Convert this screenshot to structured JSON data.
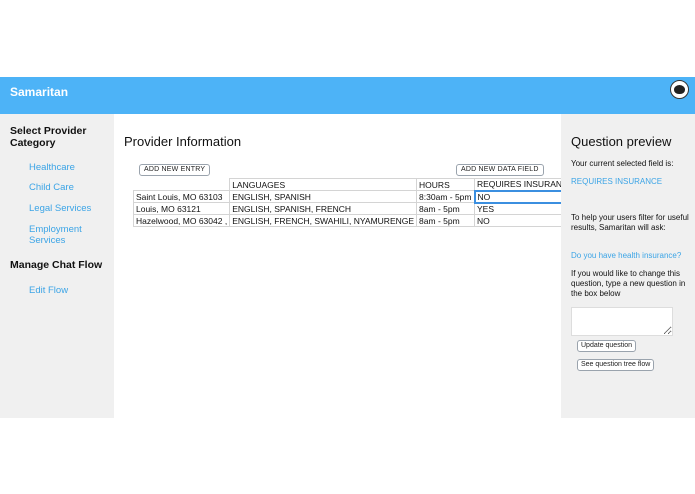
{
  "app": {
    "brand": "Samaritan",
    "logo_icon": "globe-icon"
  },
  "sidebar": {
    "select_heading": "Select Provider Category",
    "categories": [
      "Healthcare",
      "Child Care",
      "Legal Services",
      "Employment Services"
    ],
    "manage_heading": "Manage Chat Flow",
    "edit_flow": "Edit Flow"
  },
  "main": {
    "title": "Provider Information",
    "add_entry": "ADD NEW ENTRY",
    "add_field": "ADD NEW DATA FIELD",
    "columns": [
      "",
      "LANGUAGES",
      "HOURS",
      "REQUIRES INSURANCE"
    ],
    "rows": [
      [
        "Saint Louis, MO 63103",
        "ENGLISH, SPANISH",
        "8:30am - 5pm",
        "NO"
      ],
      [
        "Louis, MO 63121",
        "ENGLISH, SPANISH, FRENCH",
        "8am - 5pm",
        "YES"
      ],
      [
        ", Hazelwood, MO 63042",
        "ENGLISH, FRENCH, SWAHILI, NYAMURENGE",
        "8am - 5pm",
        "NO"
      ]
    ]
  },
  "preview": {
    "title": "Question preview",
    "current_label": "Your current selected field is:",
    "current_field": "REQUIRES INSURANCE",
    "filter_text": "To help your users filter for useful results, Samaritan will ask:",
    "question": "Do you have health insurance?",
    "change_text": "If you would like to change this question, type a new question in the box below",
    "update_btn": "Update question",
    "tree_btn": "See question tree flow"
  },
  "colors": {
    "accent": "#4db3f7",
    "link": "#3ba4e6",
    "panel": "#f0f0f0"
  }
}
